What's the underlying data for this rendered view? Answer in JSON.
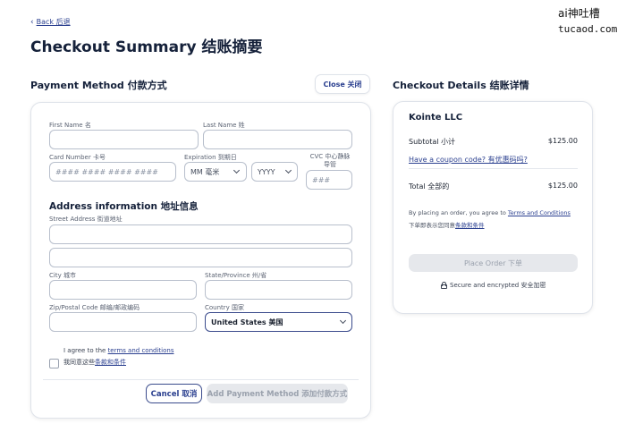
{
  "watermark": {
    "line1": "ai神吐槽",
    "line2": "tucaod.com"
  },
  "back": {
    "label": "Back 后退"
  },
  "page_title": "Checkout Summary 结账摘要",
  "payment": {
    "heading": "Payment Method 付款方式",
    "close_label": "Close 关闭",
    "first_name_label": "First Name 名",
    "last_name_label": "Last Name 姓",
    "card_number_label": "Card Number 卡号",
    "card_number_placeholder": "#### #### #### ####",
    "expiration_label": "Expiration 到期日",
    "month_value": "MM 毫米",
    "year_value": "YYYY",
    "cvc_label_1": "CVC 中心静脉",
    "cvc_label_2": "导管",
    "cvc_placeholder": "###",
    "address_heading": "Address information 地址信息",
    "street_label": "Street Address 街道地址",
    "city_label": "City 城市",
    "state_label": "State/Province 州/省",
    "zip_label": "Zip/Postal Code 邮编/邮政编码",
    "country_label": "Country 国家",
    "country_value": "United States 美国",
    "agree_prefix": "I agree to the ",
    "agree_link": "terms and conditions",
    "agree_cn_prefix": "我同意这些",
    "agree_cn_link": "条款和条件",
    "cancel_label": "Cancel 取消",
    "add_label": "Add Payment Method 添加付款方式"
  },
  "details": {
    "heading": "Checkout Details 结账详情",
    "company": "Kointe LLC",
    "subtotal_label": "Subtotal 小计",
    "subtotal_value": "$125.00",
    "coupon_link": "Have a coupon code? 有优惠码吗?",
    "total_label": "Total 全部的",
    "total_value": "$125.00",
    "legal_prefix": "By placing an order, you agree to ",
    "legal_link": "Terms and Conditions",
    "legal_cn_prefix": "下单即表示您同意",
    "legal_cn_link": "条款和条件",
    "place_order_label": "Place Order 下单",
    "secure_label": "Secure and encrypted 安全加密"
  }
}
